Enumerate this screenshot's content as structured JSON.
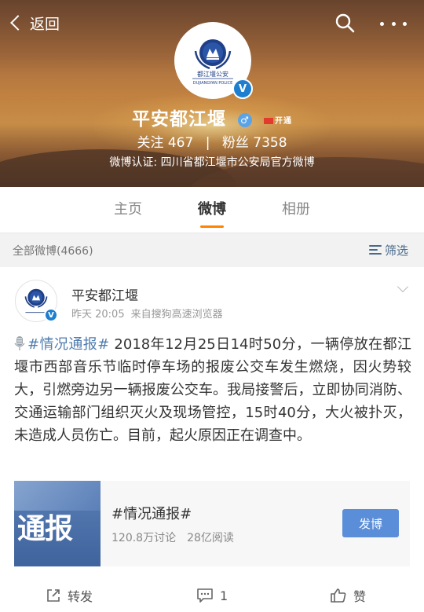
{
  "header": {
    "back_label": "返回",
    "profile_name": "平安都江堰",
    "verified_mark": "V",
    "gender_mark": "♂",
    "flag_badge_text": "开通",
    "follow_label": "关注",
    "follow_count": "467",
    "fans_label": "粉丝",
    "fans_count": "7358",
    "verify_text": "微博认证: 四川省都江堰市公安局官方微博",
    "logo_cn": "都江堰公安",
    "logo_en": "DUJIANGYAN POLICE"
  },
  "tabs": [
    {
      "label": "主页",
      "active": false
    },
    {
      "label": "微博",
      "active": true
    },
    {
      "label": "相册",
      "active": false
    }
  ],
  "filter_bar": {
    "all_posts_label": "全部微博(4666)",
    "filter_label": "筛选"
  },
  "post": {
    "author": "平安都江堰",
    "time": "昨天 20:05",
    "source": "来自搜狗高速浏览器",
    "hashtag": "#情况通报#",
    "text": " 2018年12月25日14时50分，一辆停放在都江堰市西部音乐节临时停车场的报废公交车发生燃烧，因火势较大，引燃旁边另一辆报废公交车。我局接警后，立即协同消防、交通运输部门组织灭火及现场管控，15时40分，大火被扑灭，未造成人员伤亡。目前，起火原因正在调查中。",
    "topic": {
      "thumb_text": "通报",
      "title": "#情况通报#",
      "discussion": "120.8万讨论",
      "reads": "28亿阅读",
      "button_label": "发博"
    },
    "actions": {
      "repost_label": "转发",
      "comment_count": "1",
      "like_label": "赞"
    }
  },
  "colors": {
    "accent": "#ff8200",
    "link": "#507daf",
    "verified": "#1e7ed0",
    "button": "#5b8ed8"
  }
}
